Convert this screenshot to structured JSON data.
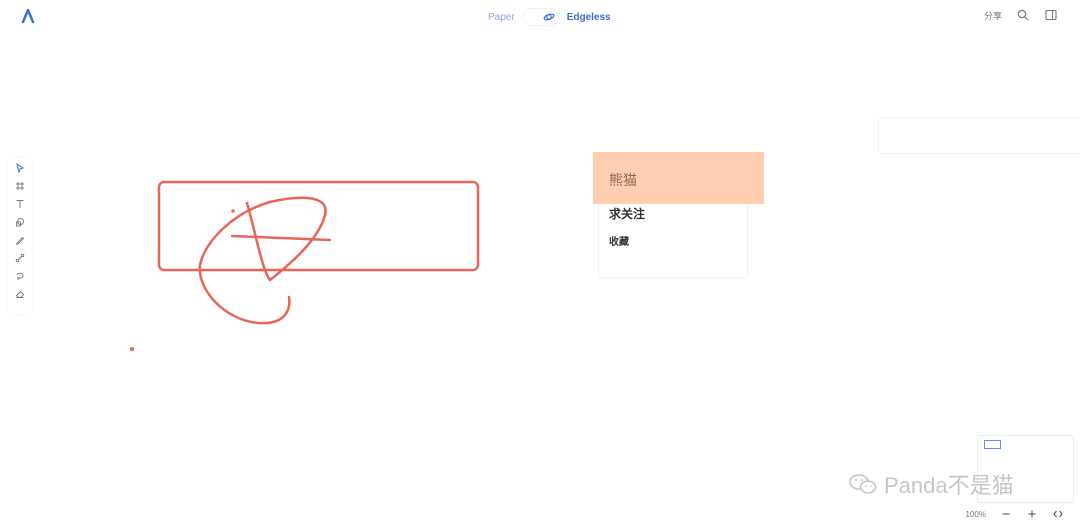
{
  "header": {
    "mode_paper": "Paper",
    "mode_edgeless": "Edgeless",
    "share_label": "分享",
    "icons": [
      "logo-icon",
      "edgeless-mode-icon",
      "search-icon",
      "sidebar-toggle-icon"
    ]
  },
  "toolbar": {
    "tools": [
      "select-tool-icon",
      "frame-tool-icon",
      "text-tool-icon",
      "shape-tool-icon",
      "pen-tool-icon",
      "connector-tool-icon",
      "lasso-tool-icon",
      "eraser-tool-icon"
    ]
  },
  "canvas": {
    "orange_block_text": "熊猫",
    "note": {
      "title": "求关注",
      "subtitle": "收藏"
    }
  },
  "watermark": {
    "text": "Panda不是猫",
    "icon": "wechat-icon"
  },
  "zoom": {
    "level": "100%",
    "icons": [
      "zoom-out-icon",
      "zoom-in-icon",
      "fit-view-icon"
    ]
  },
  "colors": {
    "accent": "#3c6fd6",
    "sketch_stroke": "#e8655a",
    "highlight_fill": "#ffcdb0"
  }
}
